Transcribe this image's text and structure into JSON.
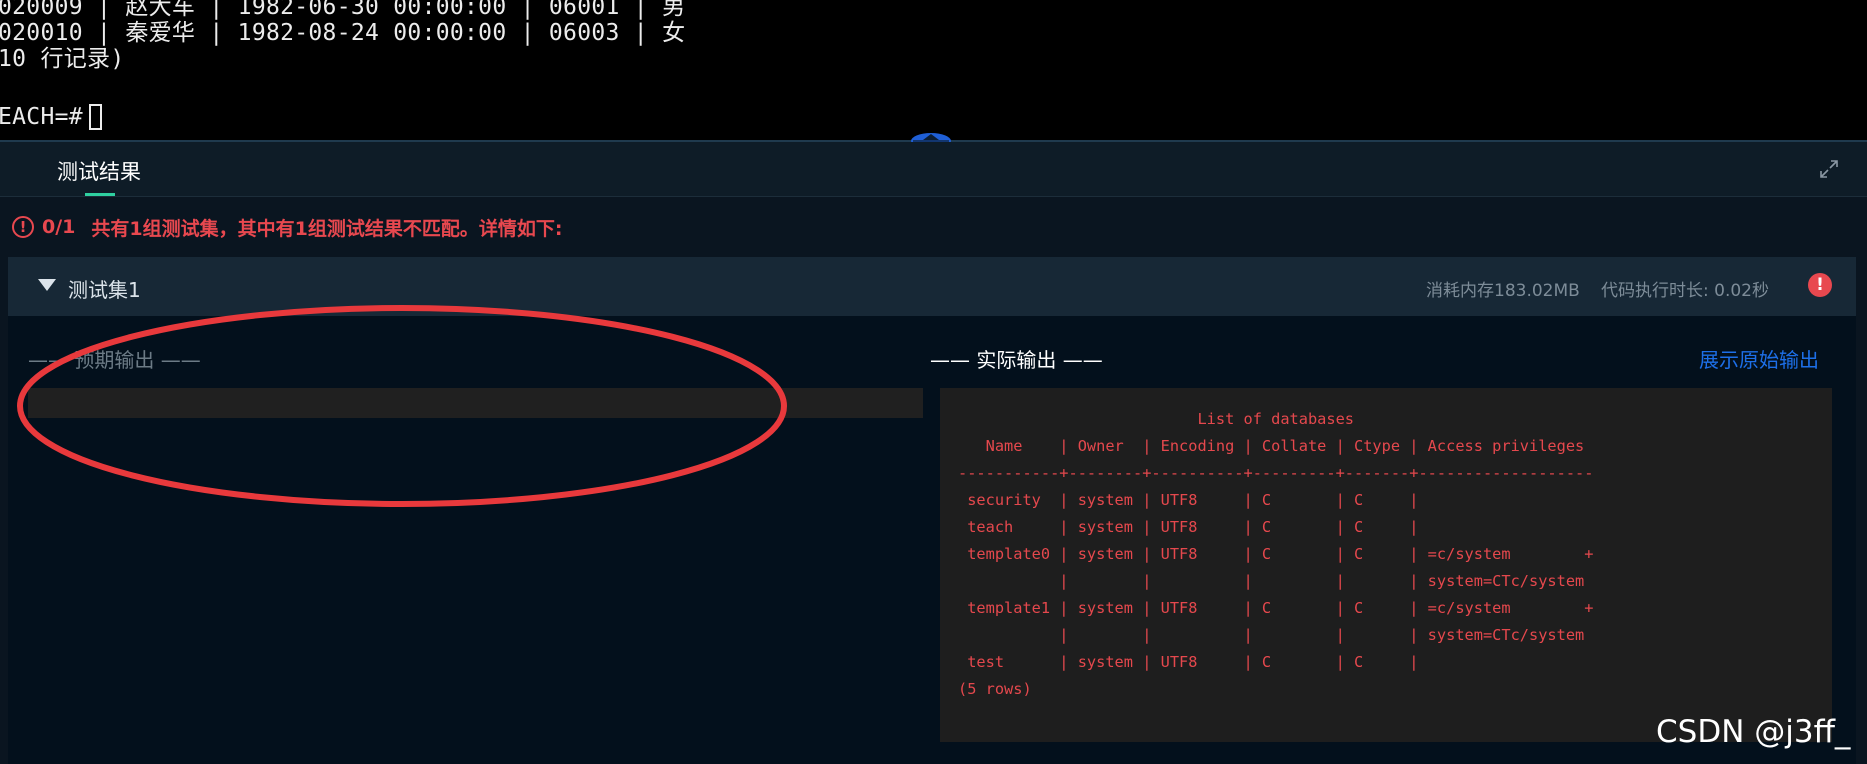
{
  "terminal": {
    "lines": [
      "020009 | 赵大车 | 1982-06-30 00:00:00 | 06001 | 男",
      "020010 | 秦爱华 | 1982-08-24 00:00:00 | 06003 | 女",
      "10 行记录)",
      "",
      "EACH=#"
    ]
  },
  "panel": {
    "tab_label": "测试结果",
    "summary_score": "0/1",
    "summary_text": "共有1组测试集，其中有1组测试结果不匹配。详情如下:",
    "alert_icon_glyph": "!",
    "status_color": "#e8484f"
  },
  "test_set": {
    "title": "测试集1",
    "memory": "消耗内存183.02MB",
    "exec_time": "代码执行时长: 0.02秒",
    "error_icon_glyph": "!",
    "expected_label": "—— 预期输出 ——",
    "actual_label": "—— 实际输出 ——",
    "show_raw_link": "展示原始输出",
    "expected_output": "",
    "actual_output": "                          List of databases\n   Name    | Owner  | Encoding | Collate | Ctype | Access privileges\n-----------+--------+----------+---------+-------+-------------------\n security  | system | UTF8     | C       | C     |\n teach     | system | UTF8     | C       | C     |\n template0 | system | UTF8     | C       | C     | =c/system        +\n           |        |          |         |       | system=CTc/system\n template1 | system | UTF8     | C       | C     | =c/system        +\n           |        |          |         |       | system=CTc/system\n test      | system | UTF8     | C       | C     |\n(5 rows)"
  },
  "watermark": "CSDN @j3ff_",
  "icons": {
    "splitter": "drag-handle-icon",
    "expand": "expand-icon",
    "alert": "alert-circle-icon",
    "toggle": "caret-down-icon"
  }
}
